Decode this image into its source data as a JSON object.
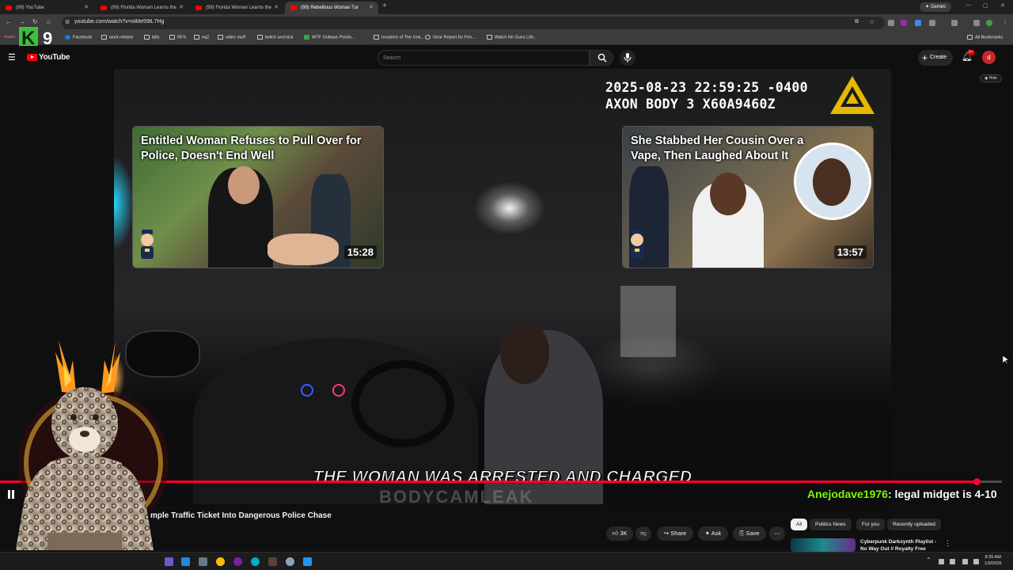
{
  "browser": {
    "tabs": [
      {
        "label": "(99) YouTube",
        "active": false
      },
      {
        "label": "(99) Florida Woman Learns the",
        "active": false
      },
      {
        "label": "(99) Florida Woman Learns the",
        "active": false
      },
      {
        "label": "(99) Rebellious Woman Tur",
        "active": true
      }
    ],
    "gemini_label": "Gemini",
    "url": "youtube.com/watch?v=oiMe59tL7Hg",
    "bookmarks": [
      "music",
      "Facebook",
      "work related",
      "bills",
      "RFS",
      "eq2",
      "video stuff",
      "twitch and kick",
      "WTF Outlaws Points...",
      "Invaders of The Unk...",
      "Gear Report for Fen...",
      "Watch No Guns Life..."
    ],
    "all_bookmarks_label": "All Bookmarks"
  },
  "overlay": {
    "logo_letter": "K",
    "logo_number": "9"
  },
  "youtube": {
    "logo_text": "YouTube",
    "search_placeholder": "Search",
    "create_label": "Create",
    "notification_count": "9+",
    "avatar_letter": "d",
    "hide_label": "Hide"
  },
  "video": {
    "timestamp_line1": "2025-08-23 22:59:25 -0400",
    "timestamp_line2": "AXON BODY 3 X60A9460Z",
    "caption": "THE WOMAN WAS ARRESTED AND CHARGED",
    "watermark": "BODYCAMLEAK",
    "progress": 0.975,
    "end_cards": [
      {
        "title": "Entitled Woman Refuses to Pull Over for Police, Doesn't End Well",
        "duration": "15:28"
      },
      {
        "title": "She Stabbed Her Cousin Over a Vape, Then Laughed About It",
        "duration": "13:57"
      }
    ],
    "title": "mple Traffic Ticket Into Dangerous Police Chase",
    "actions": {
      "likes": "3K",
      "share": "Share",
      "ask": "Ask",
      "save": "Save"
    }
  },
  "chat": {
    "username": "Anejodave1976",
    "message": ": legal midget is 4-10"
  },
  "sidebar": {
    "chips": [
      "All",
      "Politics News",
      "For you",
      "Recently uploaded"
    ],
    "rec_title": "Cyberpunk Darksynth Playlist - No Way Out // Royalty Free"
  },
  "taskbar": {
    "time": "8:26 AM",
    "date": "1/9/2026"
  },
  "colors": {
    "accent": "#ff0033",
    "chat_user": "#7CFC00",
    "youtube_red": "#ff0000"
  }
}
